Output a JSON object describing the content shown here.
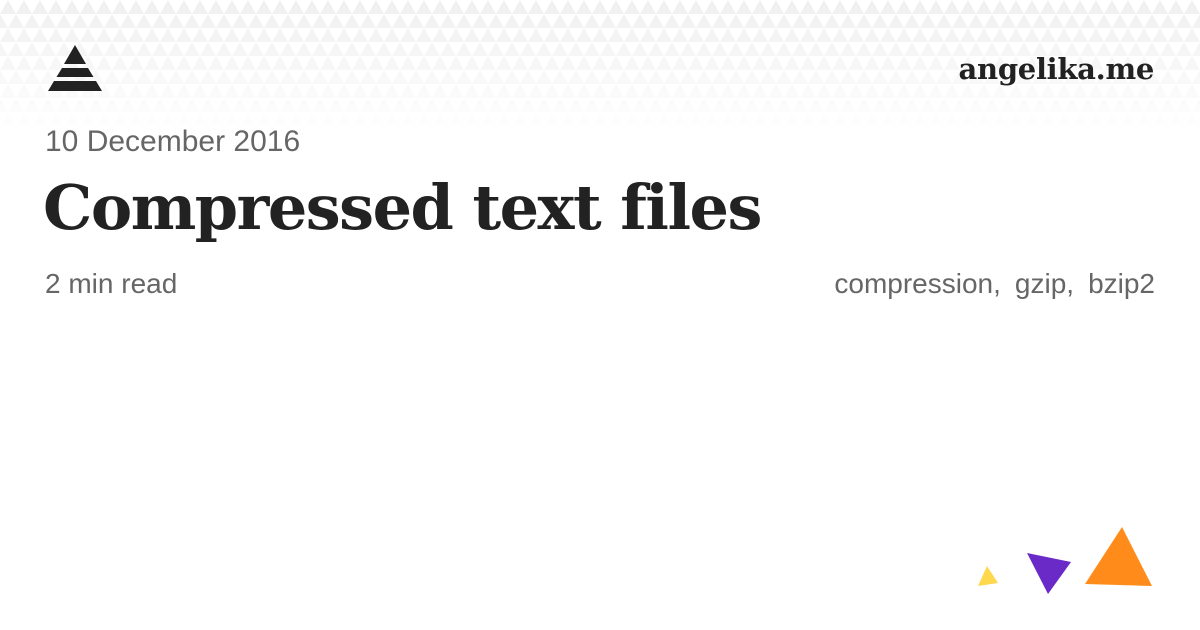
{
  "site": {
    "brand": "angelika.me",
    "logo_icon": "pyramid-icon"
  },
  "post": {
    "date": "10 December 2016",
    "title": "Compressed text files",
    "read_time": "2 min read",
    "tags": [
      "compression",
      "gzip",
      "bzip2"
    ],
    "tag_separator": ","
  },
  "decoration": {
    "icons": [
      "yellow-triangle-icon",
      "purple-triangle-icon",
      "orange-triangle-icon"
    ],
    "colors": {
      "yellow": "#ffd84d",
      "purple": "#6a2ac8",
      "orange": "#ff8c1a",
      "pattern": "#f0f0f0",
      "text_muted": "#666666",
      "text_main": "#222222"
    }
  }
}
